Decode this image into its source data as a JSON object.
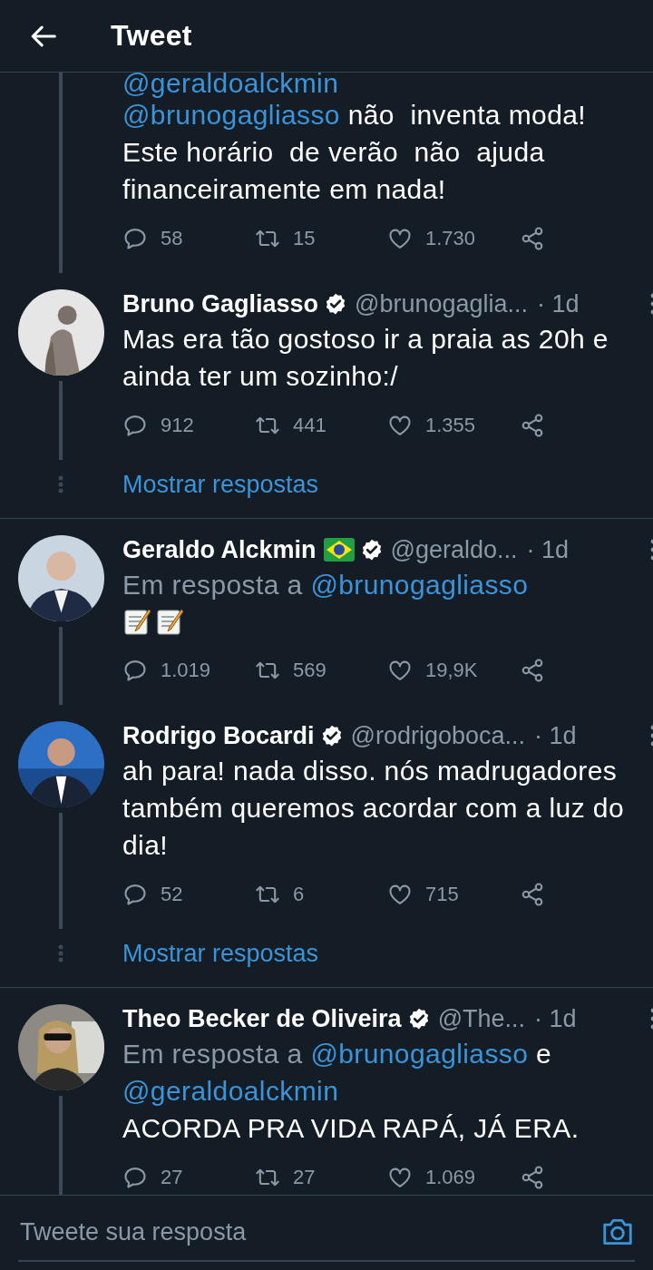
{
  "header": {
    "title": "Tweet"
  },
  "groups": [
    {
      "tweets": [
        {
          "reply_to": {
            "parts": [
              {
                "kind": "mention",
                "text": "@geraldoalckmin"
              }
            ]
          },
          "body": [
            {
              "kind": "mention",
              "text": "@brunogagliasso"
            },
            {
              "kind": "text",
              "text": "não  inventa moda! Este horário  de verão  não  ajuda financeiramente em nada!"
            }
          ],
          "actions": [
            {
              "kind": "reply",
              "count": "58"
            },
            {
              "kind": "retweet",
              "count": "15"
            },
            {
              "kind": "like",
              "count": "1.730"
            },
            {
              "kind": "share"
            }
          ]
        },
        {
          "name": "Bruno Gagliasso",
          "flag": false,
          "verified": true,
          "handle": "@brunogaglia...",
          "time": "· 1d",
          "body": [
            {
              "kind": "text",
              "text": "Mas era tão gostoso ir a praia as 20h e ainda ter um sozinho:/"
            }
          ],
          "actions": [
            {
              "kind": "reply",
              "count": "912"
            },
            {
              "kind": "retweet",
              "count": "441"
            },
            {
              "kind": "like",
              "count": "1.355"
            },
            {
              "kind": "share"
            }
          ]
        }
      ],
      "show_replies": "Mostrar respostas"
    },
    {
      "tweets": [
        {
          "name": "Geraldo Alckmin",
          "flag": true,
          "verified": true,
          "handle": "@geraldo...",
          "time": "· 1d",
          "reply_to": {
            "prefix": "Em resposta a",
            "parts": [
              {
                "kind": "mention",
                "text": "@brunogagliasso"
              }
            ]
          },
          "body": [
            {
              "kind": "memo"
            },
            {
              "kind": "memo"
            }
          ],
          "actions": [
            {
              "kind": "reply",
              "count": "1.019"
            },
            {
              "kind": "retweet",
              "count": "569"
            },
            {
              "kind": "like",
              "count": "19,9K"
            },
            {
              "kind": "share"
            }
          ]
        },
        {
          "name": "Rodrigo Bocardi",
          "flag": false,
          "verified": true,
          "handle": "@rodrigoboca...",
          "time": "· 1d",
          "body": [
            {
              "kind": "text",
              "text": "ah para! nada disso. nós madrugadores também queremos acordar com a luz do dia!"
            }
          ],
          "actions": [
            {
              "kind": "reply",
              "count": "52"
            },
            {
              "kind": "retweet",
              "count": "6"
            },
            {
              "kind": "like",
              "count": "715"
            },
            {
              "kind": "share"
            }
          ]
        }
      ],
      "show_replies": "Mostrar respostas"
    },
    {
      "tweets": [
        {
          "name": "Theo Becker de Oliveira",
          "flag": false,
          "verified": true,
          "handle": "@The...",
          "time": "· 1d",
          "reply_to": {
            "prefix": "Em resposta a",
            "parts": [
              {
                "kind": "mention",
                "text": "@brunogagliasso"
              },
              {
                "kind": "text",
                "text": "e"
              },
              {
                "kind": "mention",
                "text": "@geraldoalckmin"
              }
            ]
          },
          "body": [
            {
              "kind": "text",
              "text": "ACORDA PRA VIDA RAPÁ, JÁ ERA."
            }
          ],
          "actions": [
            {
              "kind": "reply",
              "count": "27"
            },
            {
              "kind": "retweet",
              "count": "27"
            },
            {
              "kind": "like",
              "count": "1.069"
            },
            {
              "kind": "share"
            }
          ]
        }
      ]
    }
  ],
  "reply_box": {
    "placeholder": "Tweete sua resposta"
  }
}
